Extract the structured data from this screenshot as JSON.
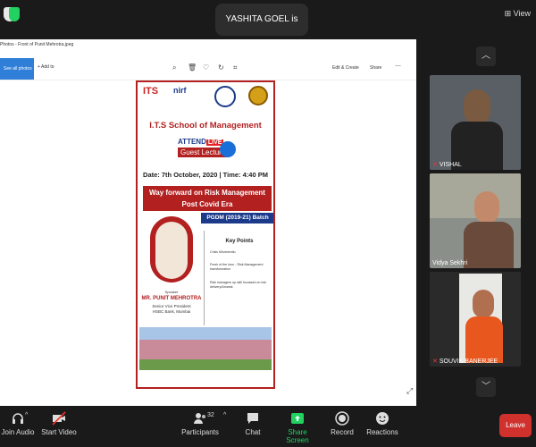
{
  "topbar": {
    "talking_text": "YASHITA GOEL is talking...",
    "view_label": "View"
  },
  "photos_app": {
    "window_title": "Photos - Front of Punit Mehrotra.jpeg",
    "see_all_label": "See all photos",
    "add_to_label": "Add to",
    "edit_create_label": "Edit & Create",
    "share_label": "Share",
    "icons": [
      "zoom-icon",
      "delete-icon",
      "favorite-icon",
      "rotate-icon",
      "crop-icon",
      "more-icon"
    ]
  },
  "poster": {
    "school_name": "I.T.S School of Management",
    "attend_label": "ATTEND",
    "live_label": "LIVE",
    "guest_lecture": "Guest Lecture",
    "date_text": "Date: 7th October, 2020 | Time: 4:40 PM",
    "topic_line1": "Way forward on Risk Management",
    "topic_line2": "Post Covid Era",
    "batch": "PGDM (2019-21) Batch",
    "key_points_title": "Key Points",
    "key_points": [
      "Crisis Mindmentio",
      "Fresh of the hour - Risk Management transformation",
      "Risk managers up skill focussed on risk delivery/Amarsk"
    ],
    "speaker_label": "Speaker",
    "speaker_name": "MR. PUNIT MEHROTRA",
    "speaker_role": "Senior Vice President",
    "speaker_org": "HSBC Bank, Mumbai"
  },
  "gallery": {
    "participants": [
      {
        "name": "VISHAL",
        "mic_muted": true
      },
      {
        "name": "Vidya Sekhri",
        "mic_muted": false
      },
      {
        "name": "SOUVIK BANERJEE",
        "mic_muted": true
      }
    ]
  },
  "bottombar": {
    "join_audio": "Join Audio",
    "start_video": "Start Video",
    "participants": "Participants",
    "participants_count": "32",
    "chat": "Chat",
    "share_screen": "Share Screen",
    "record": "Record",
    "reactions": "Reactions",
    "leave": "Leave"
  },
  "colors": {
    "share_green": "#23d160",
    "leave_red": "#d0312d",
    "poster_red": "#b32020",
    "poster_blue": "#1b3a8a"
  }
}
